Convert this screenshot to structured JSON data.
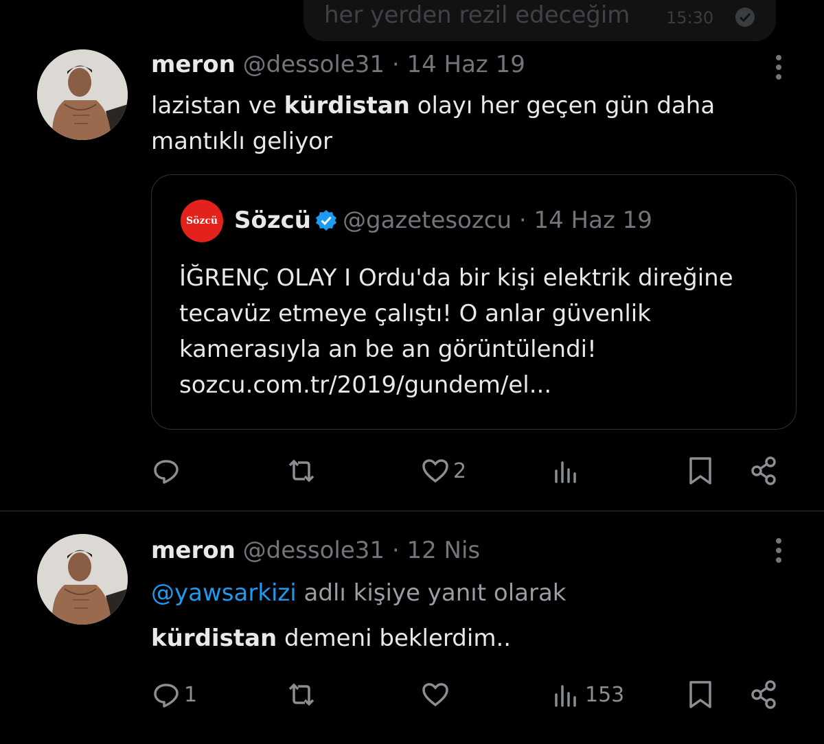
{
  "chat_bubble": {
    "text": "her yerden rezil edeceğim",
    "time": "15:30"
  },
  "tweet1": {
    "name": "meron",
    "handle": "@dessole31",
    "separator": "·",
    "date": "14 Haz 19",
    "text_part1": "lazistan ve ",
    "text_bold": "kürdistan",
    "text_part2": " olayı her geçen gün daha",
    "text_line2": "mantıklı geliyor",
    "quote": {
      "logo_text": "Sözcü",
      "name": "Sözcü",
      "handle": "@gazetesozcu",
      "separator": "·",
      "date": "14 Haz 19",
      "line1": "İĞRENÇ OLAY I Ordu'da bir kişi elektrik direğine",
      "line2": "tecavüz etmeye çalıştı! O anlar güvenlik",
      "line3": "kamerasıyla an be an görüntülendi!",
      "line4": "sozcu.com.tr/2019/gundem/el..."
    },
    "actions": {
      "replies": "",
      "retweets": "",
      "likes": "2",
      "views": ""
    }
  },
  "tweet2": {
    "name": "meron",
    "handle": "@dessole31",
    "separator": "·",
    "date": "12 Nis",
    "reply_mention": "@yawsarkizi",
    "reply_suffix": " adlı kişiye yanıt olarak",
    "text_bold": "kürdistan",
    "text_rest": " demeni beklerdim..",
    "actions": {
      "replies": "1",
      "retweets": "",
      "likes": "",
      "views": "153"
    }
  },
  "colors": {
    "background": "#000000",
    "text": "#e7e9ea",
    "secondary": "#71767b",
    "link": "#1d9bf0",
    "sozcu_red": "#e3221b",
    "verified_blue": "#1d9bf0"
  }
}
